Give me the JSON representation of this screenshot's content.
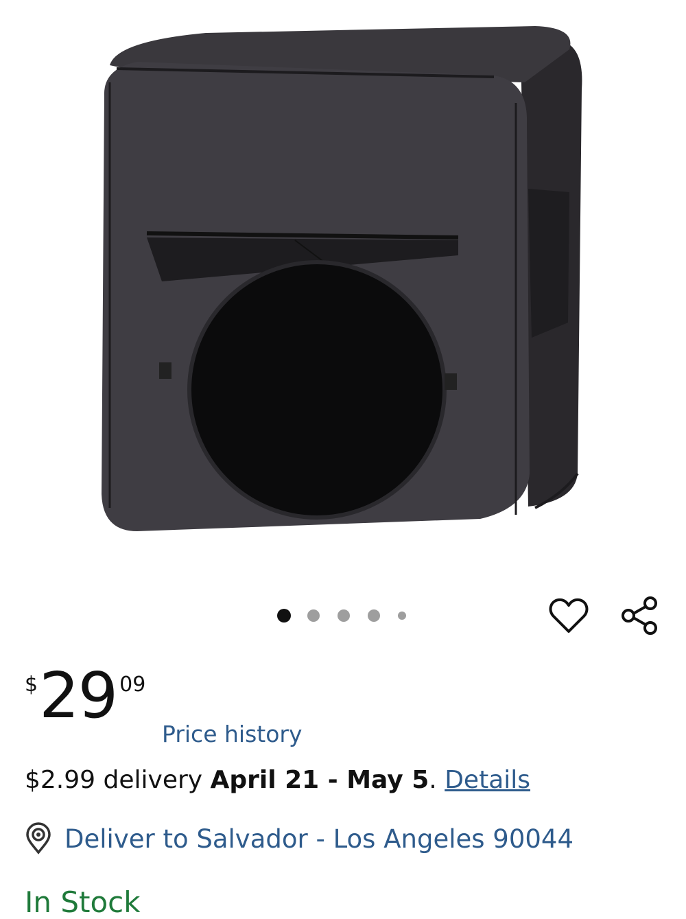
{
  "product": {
    "image_alt": "Black pop-up cube tent with round door",
    "carousel": {
      "count": 5,
      "active_index": 0
    }
  },
  "actions": {
    "favorite_icon": "heart-outline-icon",
    "share_icon": "share-icon"
  },
  "price": {
    "currency": "$",
    "dollars": "29",
    "cents": "09",
    "history_label": "Price history"
  },
  "delivery": {
    "fee": "$2.99 delivery",
    "window": "April 21 - May 5",
    "punct": ".",
    "details_label": "Details"
  },
  "location": {
    "icon": "location-pin-icon",
    "label": "Deliver to Salvador - Los Angeles 90044"
  },
  "stock": {
    "status": "In Stock",
    "color": "#1f7a3a"
  },
  "colors": {
    "link": "#2e5b8c",
    "dot_active": "#111111",
    "dot_inactive": "#9e9e9e"
  }
}
